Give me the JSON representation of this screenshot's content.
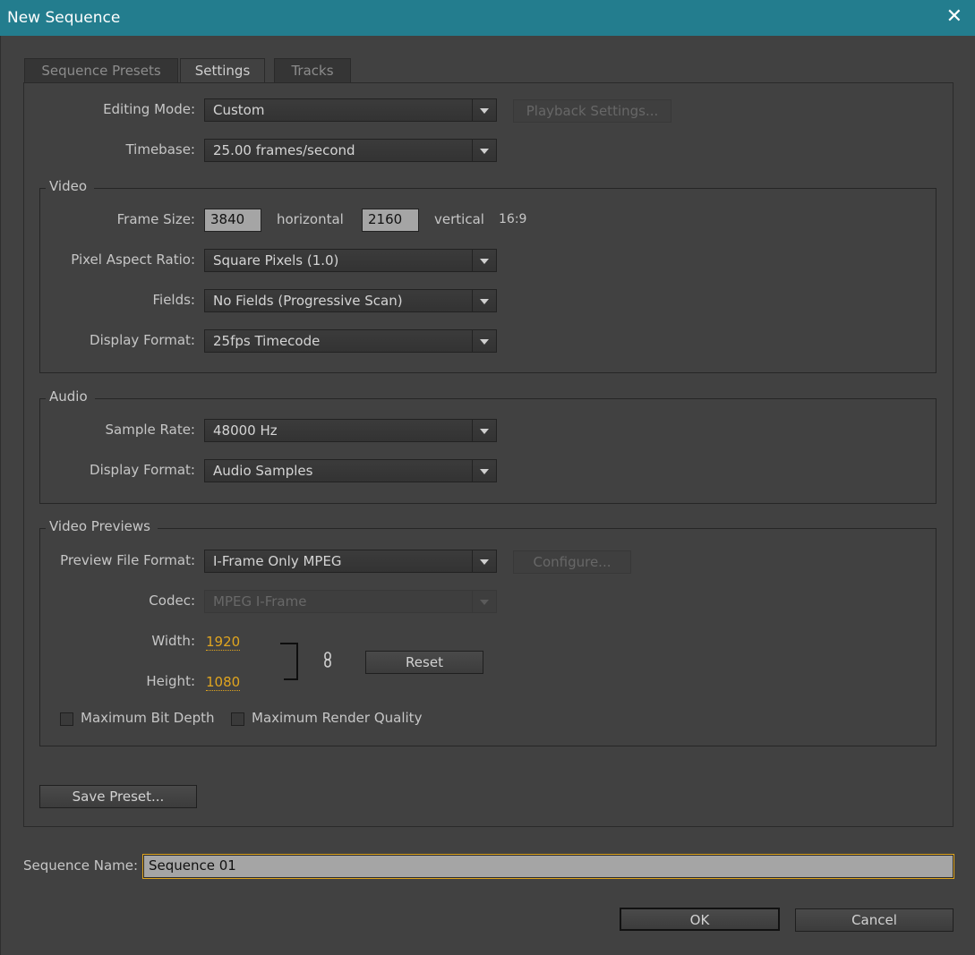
{
  "window": {
    "title": "New Sequence"
  },
  "tabs": [
    "Sequence Presets",
    "Settings",
    "Tracks"
  ],
  "active_tab": "Settings",
  "settings": {
    "editing_mode": {
      "label": "Editing Mode:",
      "value": "Custom"
    },
    "playback_settings_label": "Playback Settings...",
    "timebase": {
      "label": "Timebase:",
      "value": "25.00 frames/second"
    }
  },
  "video": {
    "title": "Video",
    "frame_size_label": "Frame Size:",
    "width": "3840",
    "horizontal_label": "horizontal",
    "height": "2160",
    "vertical_label": "vertical",
    "aspect": "16:9",
    "pixel_aspect_ratio": {
      "label": "Pixel Aspect Ratio:",
      "value": "Square Pixels (1.0)"
    },
    "fields": {
      "label": "Fields:",
      "value": "No Fields (Progressive Scan)"
    },
    "display_format": {
      "label": "Display Format:",
      "value": "25fps Timecode"
    }
  },
  "audio": {
    "title": "Audio",
    "sample_rate": {
      "label": "Sample Rate:",
      "value": "48000 Hz"
    },
    "display_format": {
      "label": "Display Format:",
      "value": "Audio Samples"
    }
  },
  "previews": {
    "title": "Video Previews",
    "preview_file_format": {
      "label": "Preview File Format:",
      "value": "I-Frame Only MPEG"
    },
    "configure_label": "Configure...",
    "codec": {
      "label": "Codec:",
      "value": "MPEG I-Frame"
    },
    "width_label": "Width:",
    "width_value": "1920",
    "height_label": "Height:",
    "height_value": "1080",
    "reset_label": "Reset",
    "max_bit_depth_label": "Maximum Bit Depth",
    "max_bit_depth_checked": false,
    "max_render_quality_label": "Maximum Render Quality",
    "max_render_quality_checked": false
  },
  "save_preset_label": "Save Preset...",
  "sequence_name": {
    "label": "Sequence Name:",
    "value": "Sequence 01"
  },
  "buttons": {
    "ok": "OK",
    "cancel": "Cancel"
  },
  "colors": {
    "titlebar": "#237d8e",
    "accent": "#e0a51f",
    "background": "#414141"
  },
  "icons": {
    "close": "close-icon",
    "dropdown": "chevron-down-icon",
    "link": "link-icon"
  }
}
